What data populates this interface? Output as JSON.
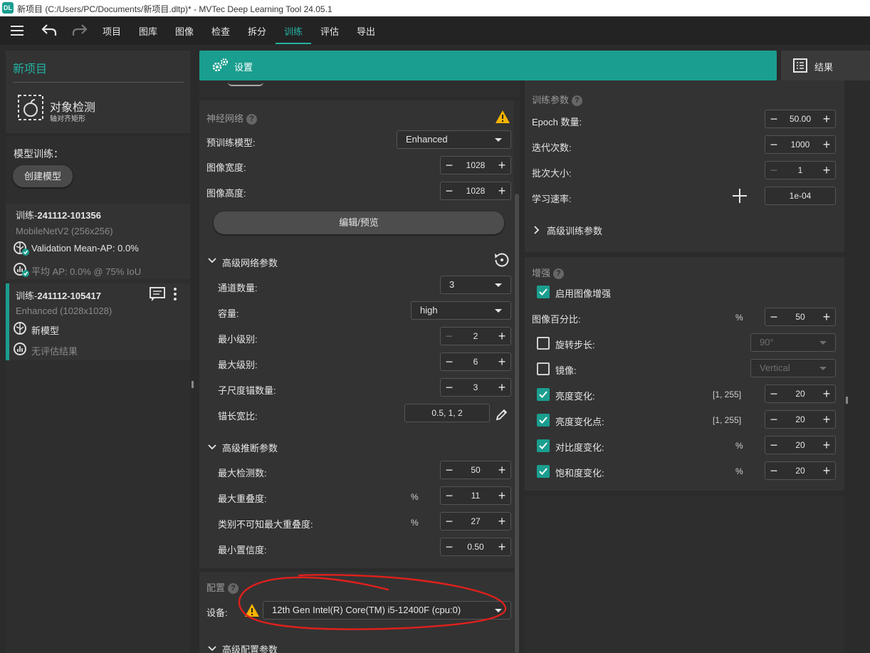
{
  "window": {
    "logo": "DL",
    "title": "新项目 (C:/Users/PC/Documents/新项目.dltp)* - MVTec Deep Learning Tool 24.05.1"
  },
  "menu": {
    "items": [
      "项目",
      "图库",
      "图像",
      "检查",
      "拆分",
      "训练",
      "评估",
      "导出"
    ],
    "active": "训练"
  },
  "sidebar": {
    "project_name": "新项目",
    "task_type": "对象检测",
    "task_subtype": "轴对齐矩形",
    "model_training_label": "模型训练：",
    "create_model_button": "创建模型",
    "trainings": [
      {
        "name_prefix": "训练-",
        "name_id": "241112-101356",
        "backbone": "MobileNetV2 (256x256)",
        "metric1": "Validation Mean-AP: 0.0%",
        "metric2": "平均 AP: 0.0% @ 75% IoU"
      },
      {
        "name_prefix": "训练-",
        "name_id": "241112-105417",
        "backbone": "Enhanced (1028x1028)",
        "metric1": "新模型",
        "metric2": "无评估结果"
      }
    ]
  },
  "tabs": {
    "settings": "设置",
    "results": "结果"
  },
  "network": {
    "title": "神经网络",
    "pretrained_label": "预训练模型:",
    "pretrained_value": "Enhanced",
    "image_width_label": "图像宽度:",
    "image_width": "1028",
    "image_height_label": "图像高度:",
    "image_height": "1028",
    "edit_button": "编辑/预览",
    "advanced_title": "高级网络参数",
    "channels_label": "通道数量:",
    "channels": "3",
    "capacity_label": "容量:",
    "capacity": "high",
    "min_level_label": "最小级别:",
    "min_level": "2",
    "max_level_label": "最大级别:",
    "max_level": "6",
    "subscales_label": "子尺度锚数量:",
    "subscales": "3",
    "aspect_label": "锚长宽比:",
    "aspect": "0.5, 1, 2"
  },
  "inference": {
    "title": "高级推断参数",
    "max_det_label": "最大检测数:",
    "max_det": "50",
    "max_overlap_label": "最大重叠度:",
    "max_overlap_unit": "%",
    "max_overlap": "11",
    "agnostic_label": "类别不可知最大重叠度:",
    "agnostic_unit": "%",
    "agnostic": "27",
    "min_conf_label": "最小置信度:",
    "min_conf": "0.50"
  },
  "config": {
    "title": "配置",
    "device_label": "设备:",
    "device": "12th Gen Intel(R) Core(TM) i5-12400F (cpu:0)",
    "advanced_title": "高级配置参数"
  },
  "training": {
    "title": "训练参数",
    "epochs_label": "Epoch 数量:",
    "epochs": "50.00",
    "iterations_label": "迭代次数:",
    "iterations": "1000",
    "batch_label": "批次大小:",
    "batch": "1",
    "lr_label": "学习速率:",
    "lr": "1e-04",
    "advanced_title": "高级训练参数"
  },
  "augmentation": {
    "title": "增强",
    "enable_label": "启用图像增强",
    "percent_label": "图像百分比:",
    "percent_unit": "%",
    "percent": "50",
    "rotation_label": "旋转步长:",
    "rotation": "90°",
    "mirror_label": "镜像:",
    "mirror": "Vertical",
    "brightness_label": "亮度变化:",
    "brightness_unit": "[1, 255]",
    "brightness": "20",
    "brightness_point_label": "亮度变化点:",
    "brightness_point_unit": "[1, 255]",
    "brightness_point": "20",
    "contrast_label": "对比度变化:",
    "contrast_unit": "%",
    "contrast": "20",
    "saturation_label": "饱和度变化:",
    "saturation_unit": "%",
    "saturation": "20"
  },
  "colors": {
    "accent": "#1a9e8f",
    "annotation": "#e0201c",
    "warning": "#f5b400"
  }
}
